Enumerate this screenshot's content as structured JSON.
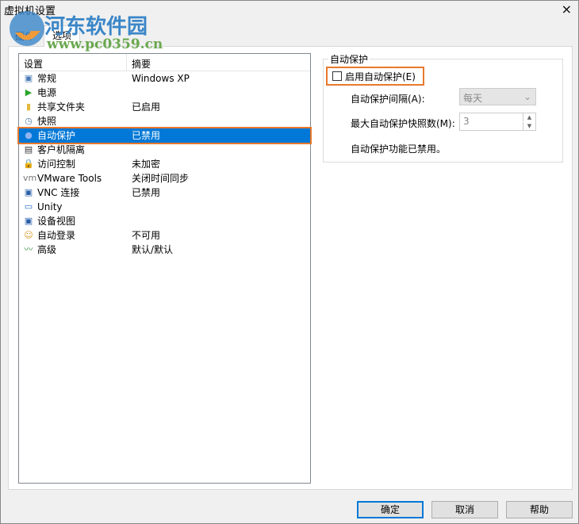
{
  "window": {
    "title": "虚拟机设置",
    "close": "×"
  },
  "tabs": [
    {
      "label": "硬件"
    },
    {
      "label": "选项"
    }
  ],
  "list": {
    "col_setting": "设置",
    "col_summary": "摘要",
    "items": [
      {
        "name": "常规",
        "summary": "Windows XP",
        "icon": "monitor-icon",
        "glyph": "▣",
        "color": "#4a7ab5"
      },
      {
        "name": "电源",
        "summary": "",
        "icon": "play-icon",
        "glyph": "▶",
        "color": "#2aa52a"
      },
      {
        "name": "共享文件夹",
        "summary": "已启用",
        "icon": "folder-icon",
        "glyph": "▮",
        "color": "#e5b83a"
      },
      {
        "name": "快照",
        "summary": "",
        "icon": "snapshot-icon",
        "glyph": "◷",
        "color": "#5a7fa8"
      },
      {
        "name": "自动保护",
        "summary": "已禁用",
        "icon": "autoprotect-icon",
        "glyph": "●",
        "color": "#8fb3f0"
      },
      {
        "name": "客户机隔离",
        "summary": "",
        "icon": "isolation-icon",
        "glyph": "▤",
        "color": "#333333"
      },
      {
        "name": "访问控制",
        "summary": "未加密",
        "icon": "lock-icon",
        "glyph": "🔒",
        "color": "#4a7ab5"
      },
      {
        "name": "VMware Tools",
        "summary": "关闭时间同步",
        "icon": "vmware-icon",
        "glyph": "vm",
        "color": "#777777"
      },
      {
        "name": "VNC 连接",
        "summary": "已禁用",
        "icon": "vnc-icon",
        "glyph": "▣",
        "color": "#2a5fa8"
      },
      {
        "name": "Unity",
        "summary": "",
        "icon": "unity-icon",
        "glyph": "▭",
        "color": "#2a6fc8"
      },
      {
        "name": "设备视图",
        "summary": "",
        "icon": "device-view-icon",
        "glyph": "▣",
        "color": "#2a5fa8"
      },
      {
        "name": "自动登录",
        "summary": "不可用",
        "icon": "user-key-icon",
        "glyph": "☺",
        "color": "#d89a2a"
      },
      {
        "name": "高级",
        "summary": "默认/默认",
        "icon": "advanced-icon",
        "glyph": "〰",
        "color": "#2a8a3a"
      }
    ],
    "selected": 4
  },
  "autoprotect": {
    "group_title": "自动保护",
    "enable_label": "启用自动保护(E)",
    "enabled": false,
    "interval_label": "自动保护间隔(A):",
    "interval_value": "每天",
    "max_label": "最大自动保护快照数(M):",
    "max_value": "3",
    "status": "自动保护功能已禁用。"
  },
  "buttons": {
    "ok": "确定",
    "cancel": "取消",
    "help": "帮助"
  },
  "watermark": {
    "name": "河东软件园",
    "url": "www.pc0359.cn"
  }
}
